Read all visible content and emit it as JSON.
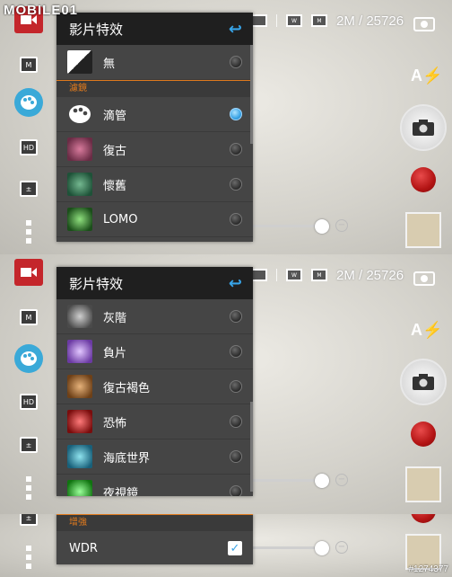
{
  "watermark": "MOBILE01",
  "image_id": "#1274377",
  "status": {
    "resolution": "2M / 25726"
  },
  "menu": {
    "title": "影片特效"
  },
  "panel1": {
    "items_top": [
      {
        "label": "無",
        "selected": false
      }
    ],
    "section": "濾鏡",
    "items": [
      {
        "label": "滴管",
        "selected": true
      },
      {
        "label": "復古",
        "selected": false
      },
      {
        "label": "懷舊",
        "selected": false
      },
      {
        "label": "LOMO",
        "selected": false
      }
    ]
  },
  "panel2": {
    "items": [
      {
        "label": "灰階",
        "selected": false
      },
      {
        "label": "負片",
        "selected": false
      },
      {
        "label": "復古褐色",
        "selected": false
      },
      {
        "label": "恐怖",
        "selected": false
      },
      {
        "label": "海底世界",
        "selected": false
      },
      {
        "label": "夜視鏡",
        "selected": false
      }
    ]
  },
  "panel3": {
    "section": "增強",
    "wdr_label": "WDR",
    "wdr_checked": true
  },
  "colors": {
    "accent": "#38a4e8",
    "section": "#e07a1d",
    "record": "#c4262b"
  }
}
